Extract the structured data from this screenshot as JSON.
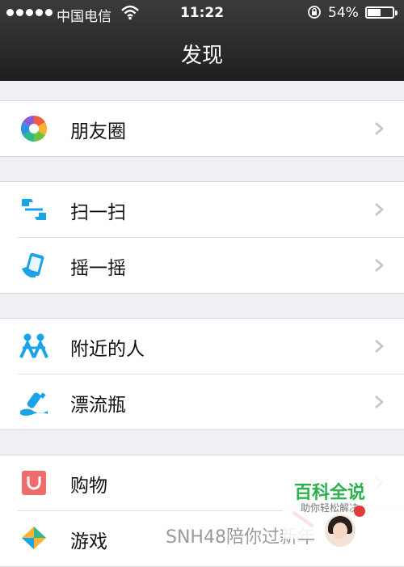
{
  "status_bar": {
    "carrier": "中国电信",
    "time": "11:22",
    "battery_percent": "54%",
    "battery_level": 0.54,
    "icons": [
      "signal-dots-icon",
      "wifi-icon",
      "rotation-lock-icon",
      "battery-icon"
    ]
  },
  "nav": {
    "title": "发现"
  },
  "sections": [
    {
      "items": [
        {
          "label": "朋友圈",
          "icon": "moments-icon"
        }
      ]
    },
    {
      "items": [
        {
          "label": "扫一扫",
          "icon": "scan-icon"
        },
        {
          "label": "摇一摇",
          "icon": "shake-icon"
        }
      ]
    },
    {
      "items": [
        {
          "label": "附近的人",
          "icon": "people-nearby-icon"
        },
        {
          "label": "漂流瓶",
          "icon": "drift-bottle-icon"
        }
      ]
    },
    {
      "items": [
        {
          "label": "购物",
          "icon": "shopping-icon"
        },
        {
          "label": "游戏",
          "icon": "games-icon"
        }
      ]
    }
  ],
  "overlay": {
    "watermark_title": "百科全说",
    "watermark_subtitle": "助你轻松解决",
    "ticker_text": "SNH48陪你过新年"
  },
  "colors": {
    "nav_bg": "#2c2c2e",
    "page_bg": "#efeff4",
    "accent_blue": "#1aa3e8",
    "watermark_green": "#2bb24c"
  }
}
